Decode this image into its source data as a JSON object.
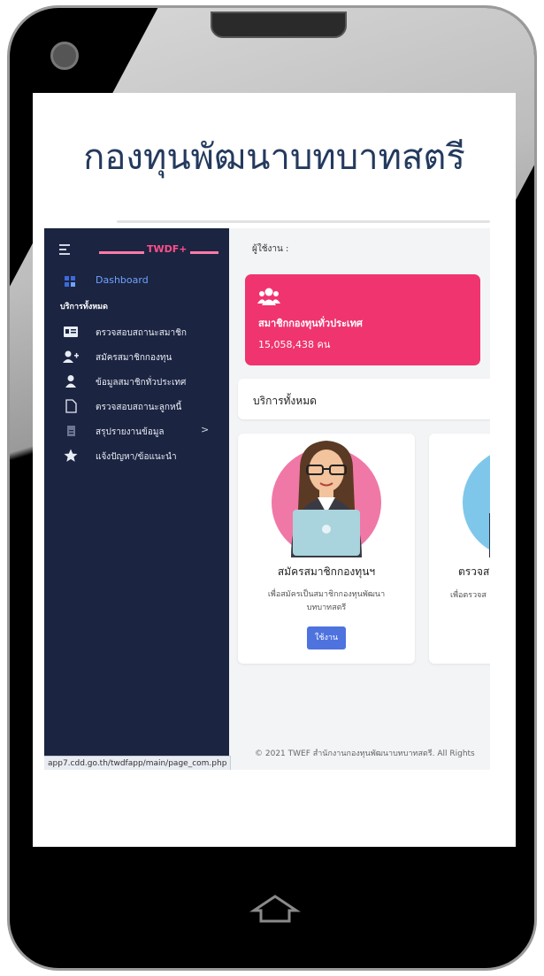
{
  "header_title": "กองทุนพัฒนาบทบาทสตรี",
  "sidebar": {
    "logo": "TWDF+",
    "dashboard_label": "Dashboard",
    "section_label": "บริการทั้งหมด",
    "items": [
      {
        "label": "ตรวจสอบสถานะสมาชิก",
        "icon": "id-card-icon"
      },
      {
        "label": "สมัครสมาชิกกองทุน",
        "icon": "user-plus-icon"
      },
      {
        "label": "ข้อมูลสมาชิกทั่วประเทศ",
        "icon": "user-icon"
      },
      {
        "label": "ตรวจสอบสถานะลูกหนี้",
        "icon": "file-icon"
      },
      {
        "label": "สรุปรายงานข้อมูล",
        "icon": "report-icon",
        "chevron": ">"
      },
      {
        "label": "แจ้งปัญหา/ข้อแนะนำ",
        "icon": "star-icon"
      }
    ],
    "status_url": "app7.cdd.go.th/twdfapp/main/page_com.php"
  },
  "main": {
    "user_label": "ผู้ใช้งาน :",
    "stat_card": {
      "label": "สมาชิกกองทุนทั่วประเทศ",
      "count": "15,058,438 คน",
      "color": "#f0346f"
    },
    "services_heading": "บริการทั้งหมด",
    "cards": [
      {
        "title": "สมัครสมาชิกกองทุนฯ",
        "desc_line1": "เพื่อสมัครเป็นสมาชิกกองทุนพัฒนา",
        "desc_line2": "บทบาทสตรี",
        "button": "ใช้งาน"
      },
      {
        "title": "ตรวจส",
        "desc_line1": "เพื่อตรวจส"
      }
    ],
    "footer": "© 2021 TWEF สำนักงานกองทุนพัฒนาบทบาทสตรี. All Rights"
  },
  "colors": {
    "sidebar": "#1b2440",
    "accent_pink": "#f0346f",
    "button": "#4e73df",
    "title": "#243a5e"
  }
}
